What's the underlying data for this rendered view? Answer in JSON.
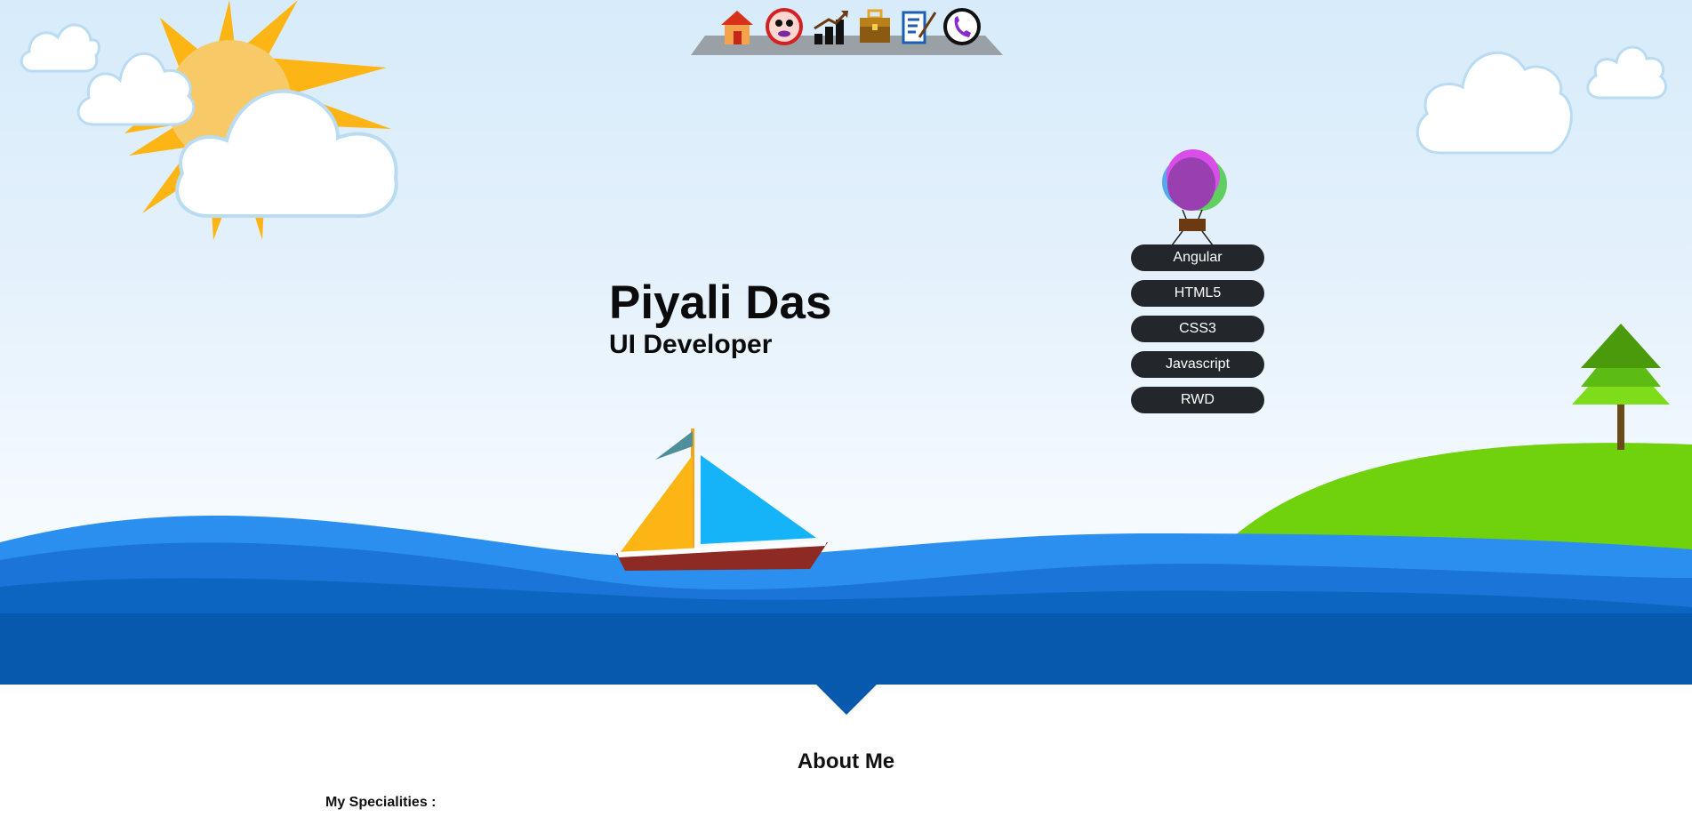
{
  "nav": {
    "items": [
      {
        "icon": "home-icon",
        "label": "Home"
      },
      {
        "icon": "about-face-icon",
        "label": "About"
      },
      {
        "icon": "growth-chart-icon",
        "label": "Skills"
      },
      {
        "icon": "briefcase-icon",
        "label": "Work"
      },
      {
        "icon": "resume-pen-icon",
        "label": "Resume"
      },
      {
        "icon": "phone-icon",
        "label": "Contact"
      }
    ]
  },
  "hero": {
    "name": "Piyali Das",
    "role": "UI Developer"
  },
  "skills": [
    "Angular",
    "HTML5",
    "CSS3",
    "Javascript",
    "RWD"
  ],
  "about": {
    "title": "About Me",
    "specialities_label": "My Specialities :"
  },
  "colors": {
    "sky_top": "#d7ebfa",
    "sun": "#fdb515",
    "sea_light": "#2b8ff0",
    "sea_dark": "#0759ad",
    "hill": "#6fd20c",
    "pill": "#23272b"
  }
}
